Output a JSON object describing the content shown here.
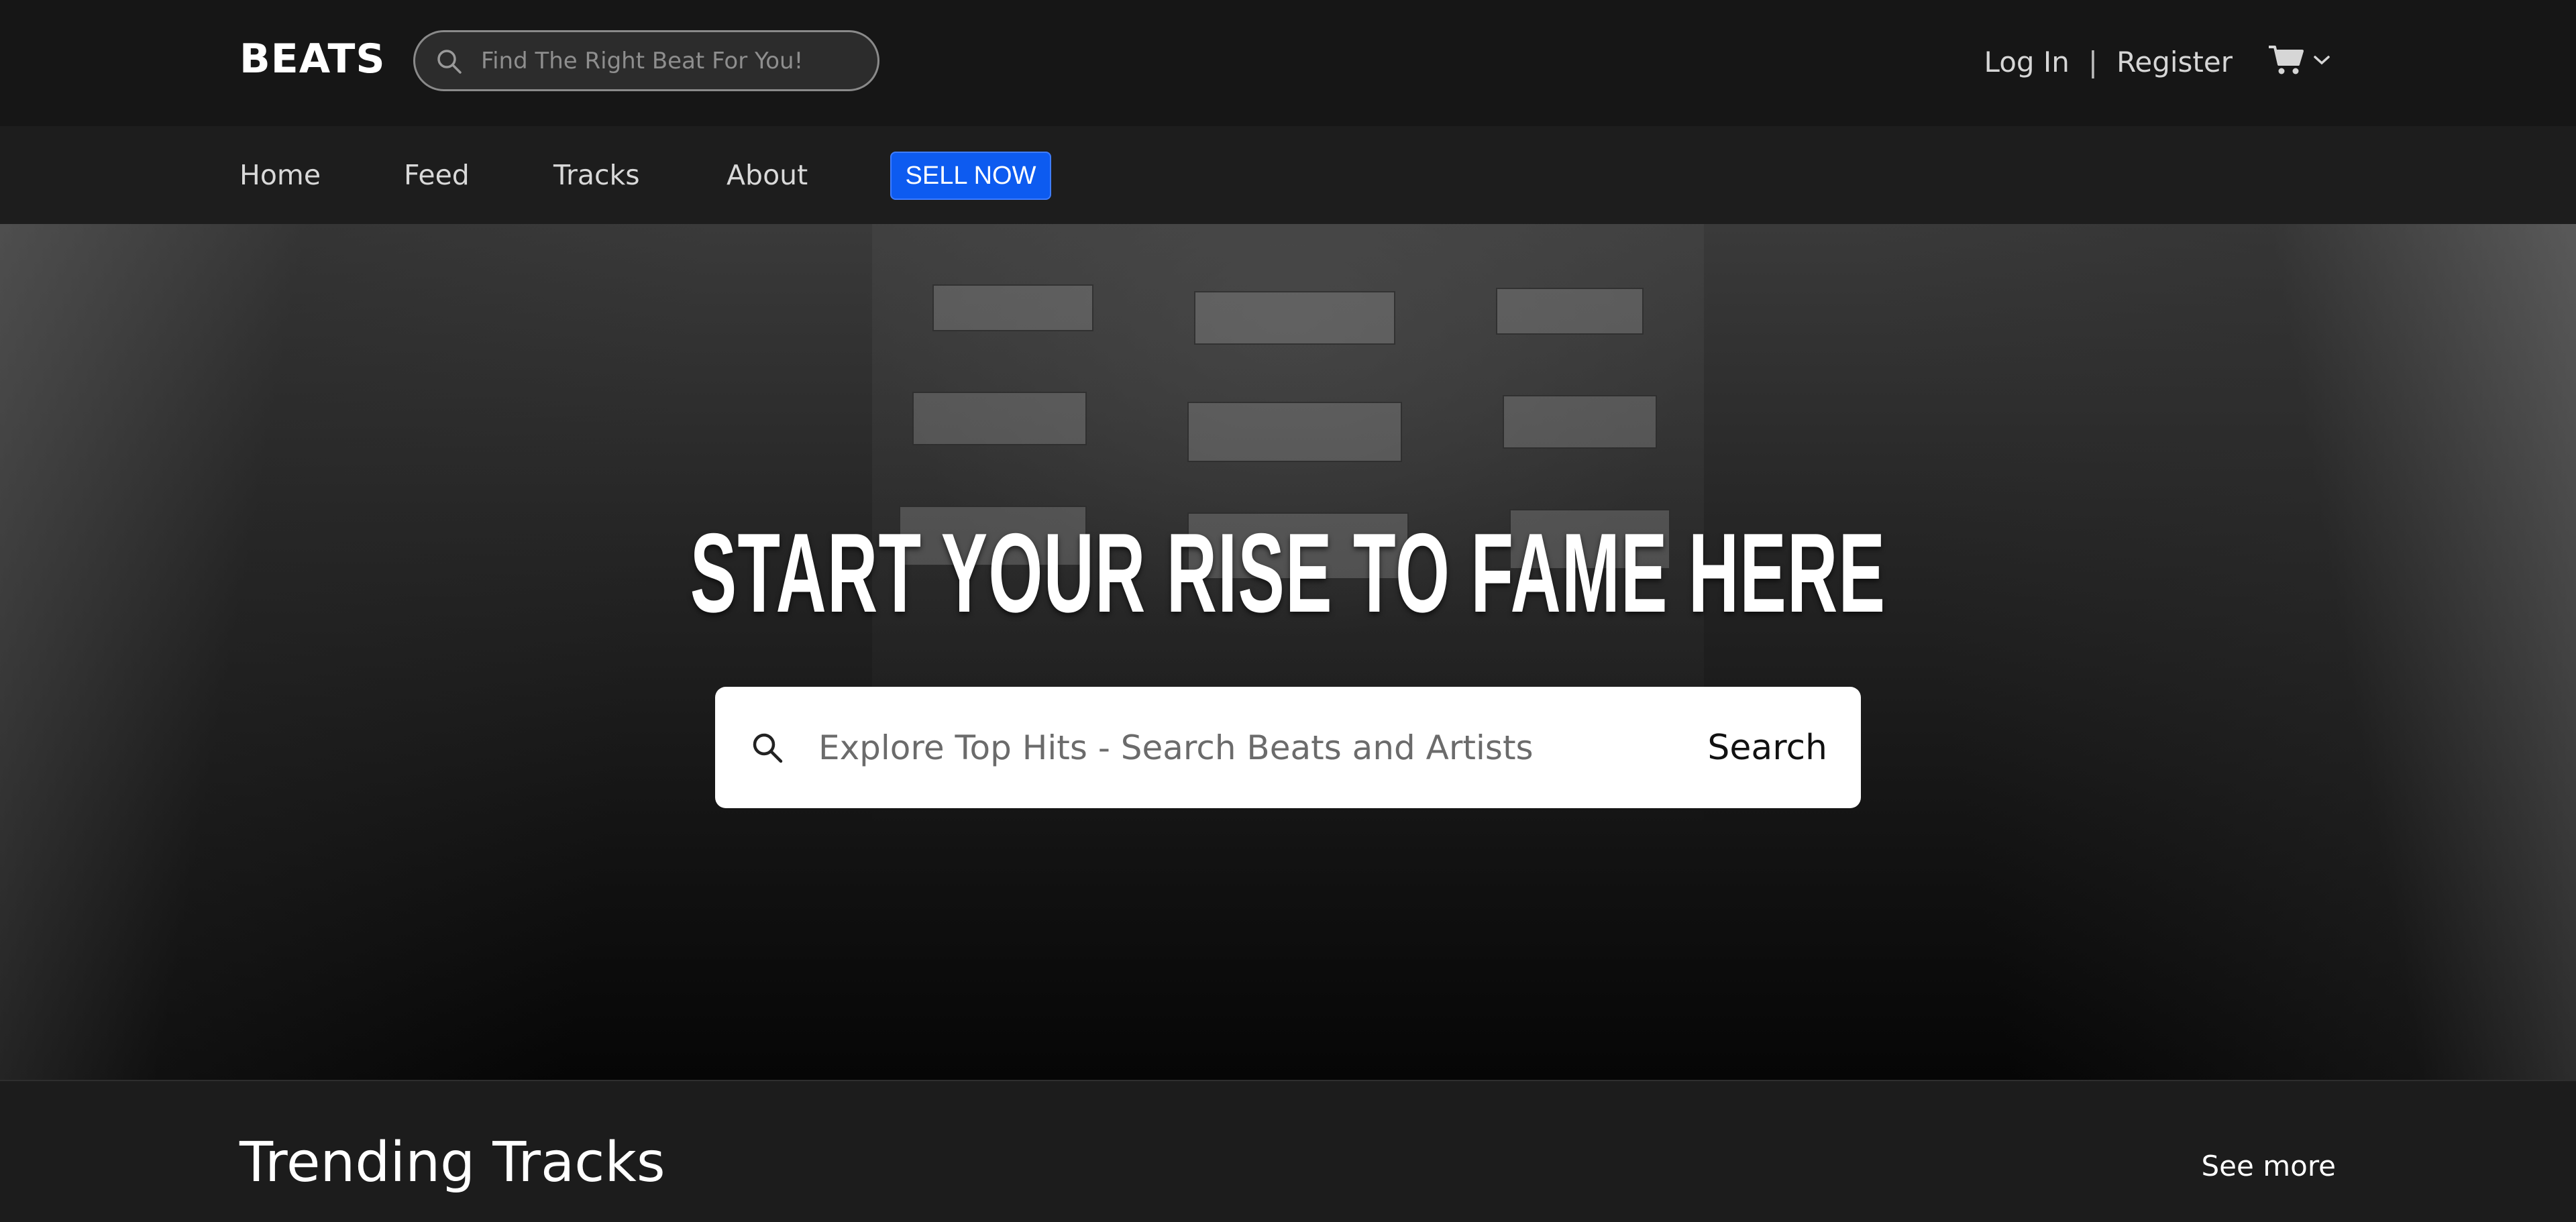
{
  "header": {
    "brand": "BEATS",
    "search_placeholder": "Find The Right Beat For You!",
    "login_label": "Log In",
    "separator": "|",
    "register_label": "Register",
    "cart_icon": "cart-icon",
    "cart_dropdown_icon": "chevron-down-icon"
  },
  "nav": {
    "items": [
      {
        "label": "Home"
      },
      {
        "label": "Feed"
      },
      {
        "label": "Tracks"
      },
      {
        "label": "About"
      }
    ],
    "sell_label": "SELL NOW",
    "sell_color": "#0d5bf0"
  },
  "hero": {
    "title": "START YOUR RISE TO FAME HERE",
    "search_placeholder": "Explore Top Hits - Search Beats and Artists",
    "search_button": "Search",
    "search_icon": "search-icon"
  },
  "trending": {
    "title": "Trending Tracks",
    "see_more": "See more"
  }
}
